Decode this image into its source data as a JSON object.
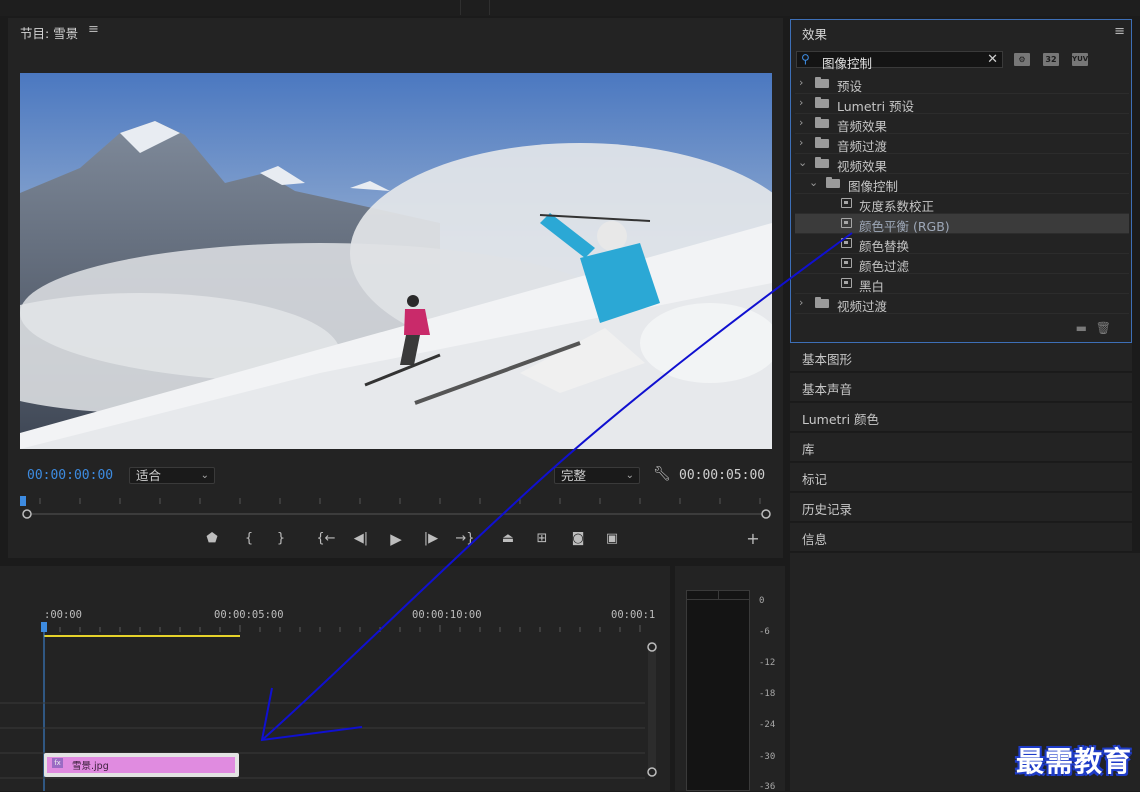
{
  "program_monitor": {
    "title": "节目: 雪景",
    "menu_glyph": "≡",
    "timecode_current": "00:00:00:00",
    "zoom_value": "适合",
    "quality_value": "完整",
    "timecode_duration": "00:00:05:00",
    "add_glyph": "+"
  },
  "effects_panel": {
    "title": "效果",
    "menu_glyph": "≡",
    "search_value": "图像控制",
    "badges": [
      "32",
      "YUV"
    ],
    "tree": [
      {
        "label": "预设",
        "expanded": false
      },
      {
        "label": "Lumetri 预设",
        "expanded": false
      },
      {
        "label": "音频效果",
        "expanded": false
      },
      {
        "label": "音频过渡",
        "expanded": false
      },
      {
        "label": "视频效果",
        "expanded": true
      },
      {
        "label": "图像控制",
        "expanded": true
      },
      {
        "label": "灰度系数校正"
      },
      {
        "label": "颜色平衡 (RGB)",
        "selected": true
      },
      {
        "label": "颜色替换"
      },
      {
        "label": "颜色过滤"
      },
      {
        "label": "黑白"
      },
      {
        "label": "视频过渡",
        "expanded": false
      }
    ]
  },
  "collapsed_panels": [
    "基本图形",
    "基本声音",
    "Lumetri 颜色",
    "库",
    "标记",
    "历史记录",
    "信息"
  ],
  "timeline": {
    "ruler_labels": [
      ":00:00",
      "00:00:05:00",
      "00:00:10:00",
      "00:00:1"
    ],
    "clip_name": "雪景.jpg",
    "clip_badge": "fx"
  },
  "audio_meter": {
    "scale": [
      "0",
      "-6",
      "-12",
      "-18",
      "-24",
      "-30",
      "-36"
    ]
  },
  "watermark": "最需教育",
  "colors": {
    "accent_blue": "#3d8be0",
    "panel_focus_border": "#3d6fb7",
    "clip_pink": "#e08be0",
    "work_area_yellow": "#e6d22a",
    "annotation_arrow": "#1010d0"
  }
}
